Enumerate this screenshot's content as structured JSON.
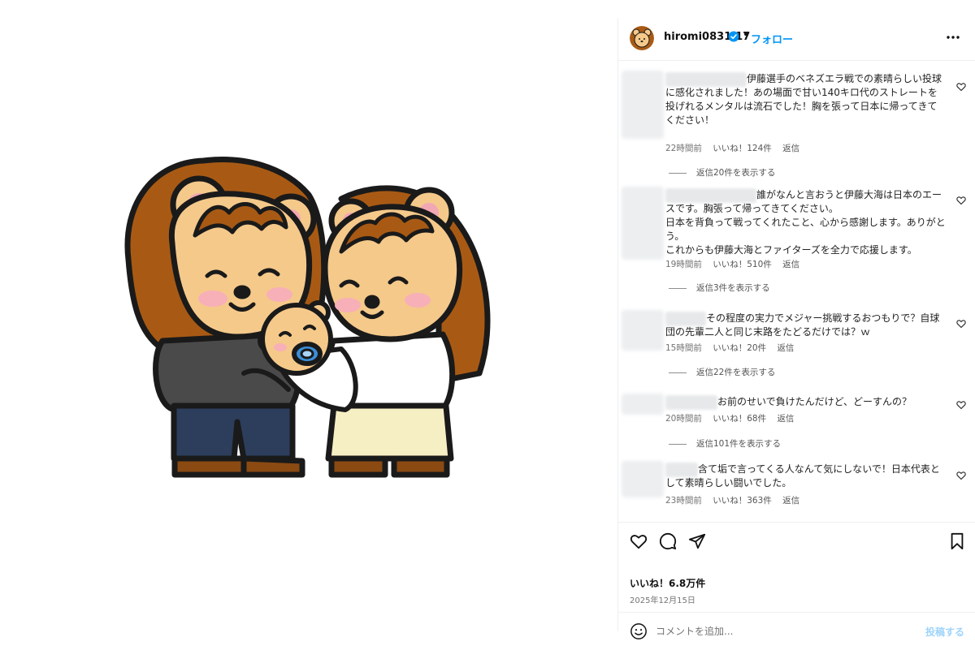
{
  "post": {
    "username": "hiromi0831.17",
    "separator": "•",
    "follow_label": "フォロー",
    "likes_text": "いいね！6.8万件",
    "date_text": "2025年12月15日",
    "comment_placeholder": "コメントを追加...",
    "post_button": "投稿する"
  },
  "comments": [
    {
      "text": "伊藤選手のベネズエラ戦での素晴らしい投球に感化されました！あの場面で甘い140キロ代のストレートを投げれるメンタルは流石でした！胸を張って日本に帰ってきてください！",
      "time": "22時間前",
      "likes": "いいね！124件",
      "reply": "返信",
      "replies": "返信20件を表示する"
    },
    {
      "text": "誰がなんと言おうと伊藤大海は日本のエースです。胸張って帰ってきてください。\n日本を背負って戦ってくれたこと、心から感謝します。ありがとう。\nこれからも伊藤大海とファイターズを全力で応援します。",
      "time": "19時間前",
      "likes": "いいね！510件",
      "reply": "返信",
      "replies": "返信3件を表示する"
    },
    {
      "text": "その程度の実力でメジャー挑戦するおつもりで？自球団の先輩二人と同じ末路をたどるだけでは？ｗ",
      "time": "15時間前",
      "likes": "いいね！20件",
      "reply": "返信",
      "replies": "返信22件を表示する"
    },
    {
      "text": "お前のせいで負けたんだけど、どーすんの？",
      "time": "20時間前",
      "likes": "いいね！68件",
      "reply": "返信",
      "replies": "返信101件を表示する"
    },
    {
      "text": "含て垢で言ってくる人なんて気にしないで！日本代表として素晴らしい闘いでした。",
      "time": "23時間前",
      "likes": "いいね！363件",
      "reply": "返信",
      "replies": ""
    }
  ],
  "icons": {
    "avatar": "bear-avatar-icon",
    "verified": "verified-badge-icon",
    "more": "more-options-icon",
    "like": "heart-icon",
    "comment": "comment-icon",
    "share": "share-icon",
    "save": "bookmark-icon",
    "emoji": "emoji-icon"
  },
  "colors": {
    "accent": "#0095f6",
    "muted": "#737373",
    "bear_brown": "#a85a14",
    "bear_face": "#f5c98a"
  }
}
